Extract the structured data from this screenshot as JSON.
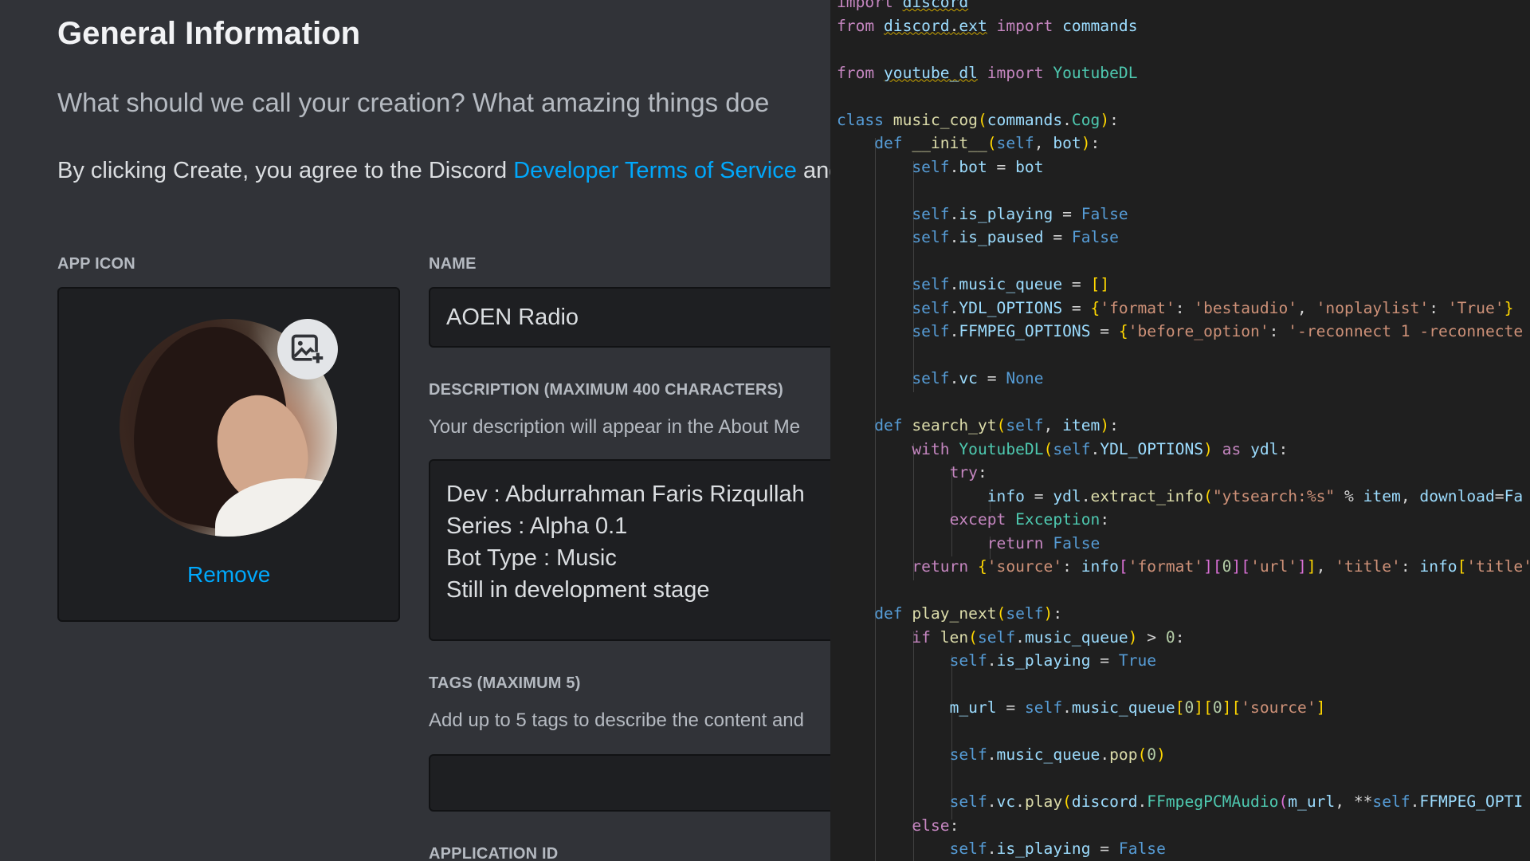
{
  "portal": {
    "title": "General Information",
    "subtitle": "What should we call your creation? What amazing things doe",
    "terms_prefix": "By clicking Create, you agree to the Discord ",
    "terms_link": "Developer Terms of Service",
    "terms_suffix": " and",
    "app_icon_label": "APP ICON",
    "remove_label": "Remove",
    "name_label": "NAME",
    "name_value": "AOEN Radio",
    "description_label": "DESCRIPTION (MAXIMUM 400 CHARACTERS)",
    "description_hint": "Your description will appear in the About Me",
    "description_lines": [
      "Dev : Abdurrahman Faris Rizqullah",
      "Series : Alpha 0.1",
      "Bot Type : Music",
      "Still in development stage"
    ],
    "tags_label": "TAGS (MAXIMUM 5)",
    "tags_hint": "Add up to 5 tags to describe the content and",
    "tags_value": "",
    "application_id_label": "APPLICATION ID",
    "add_image_icon": "image-plus-icon",
    "accent_link": "#00a8fc"
  },
  "editor": {
    "language": "python",
    "lines": [
      "import discord",
      "from discord.ext import commands",
      "",
      "from youtube_dl import YoutubeDL",
      "",
      "class music_cog(commands.Cog):",
      "    def __init__(self, bot):",
      "        self.bot = bot",
      "",
      "        self.is_playing = False",
      "        self.is_paused = False",
      "",
      "        self.music_queue = []",
      "        self.YDL_OPTIONS = {'format': 'bestaudio', 'noplaylist': 'True'}",
      "        self.FFMPEG_OPTIONS = {'before_option': '-reconnect 1 -reconnecte",
      "",
      "        self.vc = None",
      "",
      "    def search_yt(self, item):",
      "        with YoutubeDL(self.YDL_OPTIONS) as ydl:",
      "            try:",
      "                info = ydl.extract_info(\"ytsearch:%s\" % item, download=Fa",
      "            except Exception:",
      "                return False",
      "        return {'source': info['format'][0]['url']], 'title': info['title'",
      "",
      "    def play_next(self):",
      "        if len(self.music_queue) > 0:",
      "            self.is_playing = True",
      "",
      "            m_url = self.music_queue[0][0]['source']",
      "",
      "            self.music_queue.pop(0)",
      "",
      "            self.vc.play(discord.FFmpegPCMAudio(m_url, **self.FFMPEG_OPTI",
      "        else:",
      "            self.is_playing = False"
    ]
  }
}
